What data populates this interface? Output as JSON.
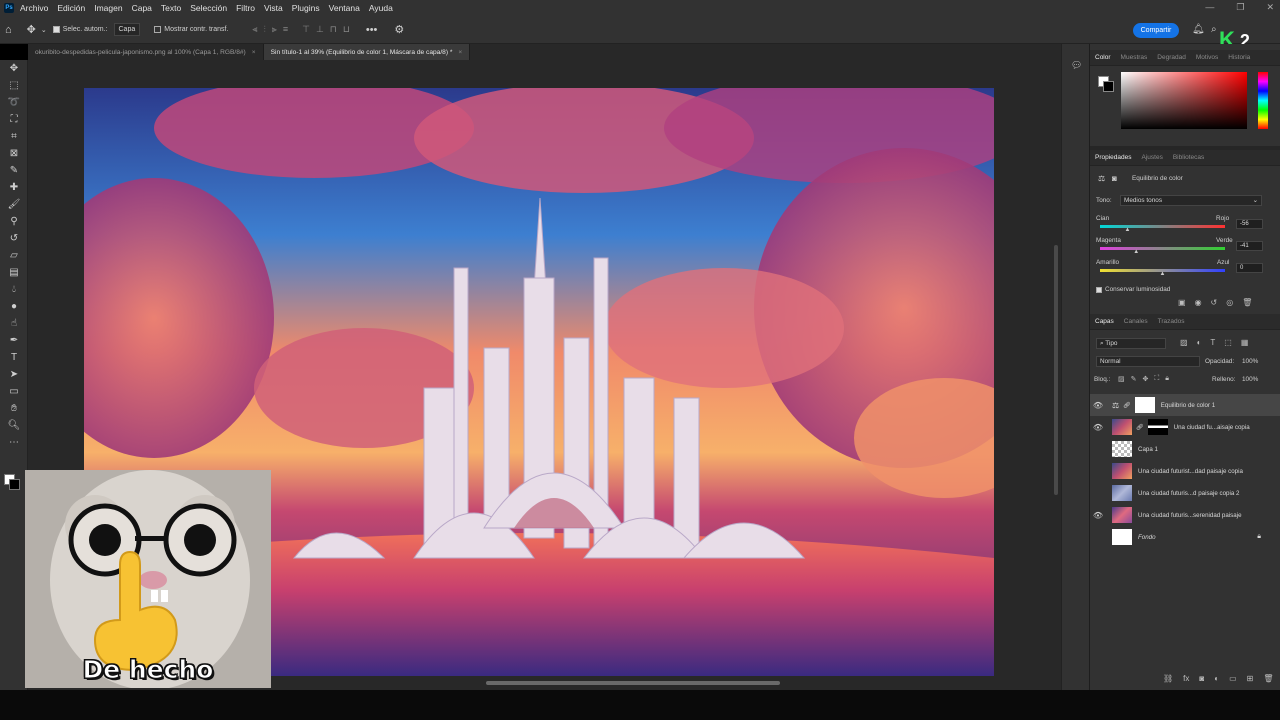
{
  "menubar": {
    "app_icon": "Ps",
    "items": [
      "Archivo",
      "Edición",
      "Imagen",
      "Capa",
      "Texto",
      "Selección",
      "Filtro",
      "Vista",
      "Plugins",
      "Ventana",
      "Ayuda"
    ]
  },
  "options": {
    "auto_select_label": "Selec. autom.:",
    "auto_select_value": "Capa",
    "show_transform_label": "Mostrar contr. transf.",
    "share_label": "Compartir"
  },
  "badge": {
    "k": "K",
    "num": "2"
  },
  "tabs": [
    {
      "label": "okuribito-despedidas-pelicula-japonismo.png al 100% (Capa 1, RGB/8#)",
      "close": "×"
    },
    {
      "label": "Sin título-1 al 39% (Equilibrio de color 1, Máscara de capa/8) *",
      "close": "×"
    }
  ],
  "meme": {
    "caption": "De hecho"
  },
  "color_panel": {
    "tabs": [
      "Color",
      "Muestras",
      "Degradad",
      "Motivos",
      "Historia"
    ]
  },
  "properties": {
    "tabs": [
      "Propiedades",
      "Ajustes",
      "Bibliotecas"
    ],
    "adjustment_name": "Equilibrio de color",
    "tone_label": "Tono:",
    "tone_value": "Medios tonos",
    "sliders": [
      {
        "left": "Cian",
        "right": "Rojo",
        "value": "-56",
        "pos": 0.22
      },
      {
        "left": "Magenta",
        "right": "Verde",
        "value": "-41",
        "pos": 0.29
      },
      {
        "left": "Amarillo",
        "right": "Azul",
        "value": "0",
        "pos": 0.5
      }
    ],
    "preserve_label": "Conservar luminosidad"
  },
  "layers_panel": {
    "tabs": [
      "Capas",
      "Canales",
      "Trazados"
    ],
    "filter_label": "Tipo",
    "blend_mode": "Normal",
    "opacity_label": "Opacidad:",
    "opacity_value": "100%",
    "lock_label": "Bloq.:",
    "fill_label": "Relleno:",
    "fill_value": "100%",
    "layers": [
      {
        "name": "Equilibrio de color 1"
      },
      {
        "name": "Una ciudad fu...aisaje copia"
      },
      {
        "name": "Capa 1"
      },
      {
        "name": "Una ciudad futurist...dad paisaje copia"
      },
      {
        "name": "Una ciudad futuris...d paisaje copia 2"
      },
      {
        "name": "Una ciudad futuris...serenidad paisaje"
      },
      {
        "name": "Fondo"
      }
    ]
  }
}
